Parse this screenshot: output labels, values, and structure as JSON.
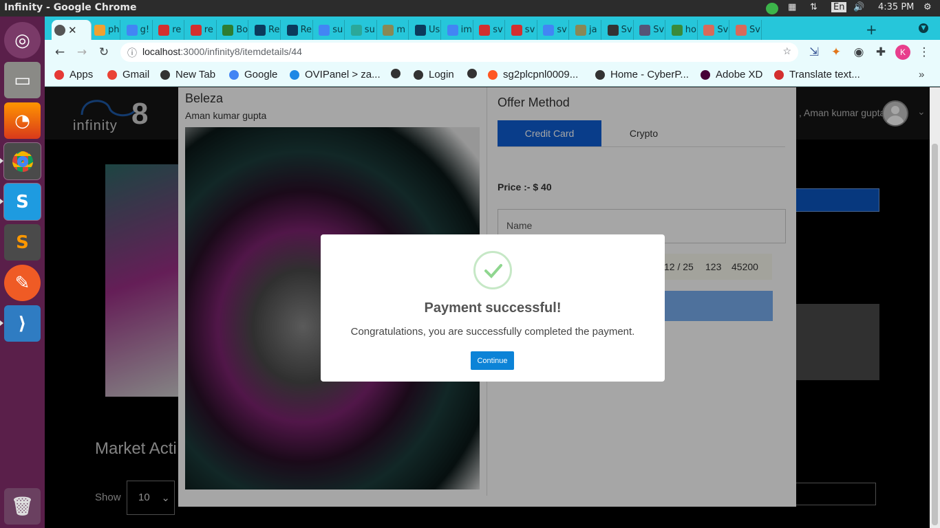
{
  "os": {
    "window_title": "Infinity - Google Chrome",
    "keyboard_lang": "En",
    "clock": "4:35 PM"
  },
  "browser": {
    "tabs": [
      {
        "label": "",
        "favicon": "globe-icon",
        "color": "#555555"
      },
      {
        "label": "ph",
        "favicon": "pma-icon",
        "color": "#f0a030"
      },
      {
        "label": "g!",
        "favicon": "google-icon",
        "color": "#4285f4"
      },
      {
        "label": "re",
        "favicon": "n-icon",
        "color": "#d32f2f"
      },
      {
        "label": "re",
        "favicon": "n-icon",
        "color": "#d32f2f"
      },
      {
        "label": "Bo",
        "favicon": "leaf-icon",
        "color": "#2e7d32"
      },
      {
        "label": "Re",
        "favicon": "react-icon",
        "color": "#0b3a5c"
      },
      {
        "label": "Re",
        "favicon": "react-icon",
        "color": "#0b3a5c"
      },
      {
        "label": "su",
        "favicon": "google-icon",
        "color": "#4285f4"
      },
      {
        "label": "su",
        "favicon": "star-icon",
        "color": "#2ba89a"
      },
      {
        "label": "m",
        "favicon": "m-icon",
        "color": "#888855"
      },
      {
        "label": "Us",
        "favicon": "react-icon",
        "color": "#0b3a5c"
      },
      {
        "label": "im",
        "favicon": "google-icon",
        "color": "#4285f4"
      },
      {
        "label": "sv",
        "favicon": "n-icon",
        "color": "#d32f2f"
      },
      {
        "label": "sv",
        "favicon": "n-icon",
        "color": "#d32f2f"
      },
      {
        "label": "sv",
        "favicon": "google-icon",
        "color": "#4285f4"
      },
      {
        "label": "ja",
        "favicon": "m-icon",
        "color": "#888855"
      },
      {
        "label": "Sv",
        "favicon": "globe-icon",
        "color": "#333333"
      },
      {
        "label": "Sv",
        "favicon": "blob-icon",
        "color": "#555577"
      },
      {
        "label": "ho",
        "favicon": "cube-icon",
        "color": "#3a8a3a"
      },
      {
        "label": "Sv",
        "favicon": "swirl-icon",
        "color": "#d86a5a"
      },
      {
        "label": "Sv",
        "favicon": "swirl-icon",
        "color": "#d86a5a"
      }
    ],
    "url_host": "localhost",
    "url_rest": ":3000/infinity8/itemdetails/44",
    "profile_initial": "K",
    "bookmarks": [
      {
        "label": "Apps",
        "color": "#e53935"
      },
      {
        "label": "Gmail",
        "color": "#ea4335"
      },
      {
        "label": "New Tab",
        "color": "#333333"
      },
      {
        "label": "Google",
        "color": "#4285f4"
      },
      {
        "label": "OVIPanel > za...",
        "color": "#1e88e5"
      },
      {
        "label": "",
        "color": "#333333"
      },
      {
        "label": "Login",
        "color": "#333333"
      },
      {
        "label": "",
        "color": "#333333"
      },
      {
        "label": "sg2plcpnl0009...",
        "color": "#ff5722"
      },
      {
        "label": "Home - CyberP...",
        "color": "#333333"
      },
      {
        "label": "Adobe XD",
        "color": "#470137"
      },
      {
        "label": "Translate text...",
        "color": "#d32f2f"
      }
    ]
  },
  "site": {
    "logo_text": "infinity",
    "logo_number": "8",
    "user_name": ", Aman kumar gupta",
    "market_title": "Market Acti",
    "show_label": "Show",
    "show_value": "10"
  },
  "item_modal": {
    "title": "Beleza",
    "owner": "Aman kumar gupta",
    "offer_title": "Offer Method",
    "tab_credit_card": "Credit Card",
    "tab_crypto": "Crypto",
    "price": "Price :- $ 40",
    "name_placeholder": "Name",
    "card_expiry": "12 / 25",
    "card_cvc": "123",
    "card_zip": "45200"
  },
  "dialog": {
    "title": "Payment successful!",
    "message": "Congratulations, you are successfully completed the payment.",
    "button": "Continue"
  },
  "colors": {
    "accent": "#0e5fd4",
    "dialog_button": "#0c83d7",
    "tabstrip": "#26c6da",
    "launcher": "#5a1f4a"
  }
}
